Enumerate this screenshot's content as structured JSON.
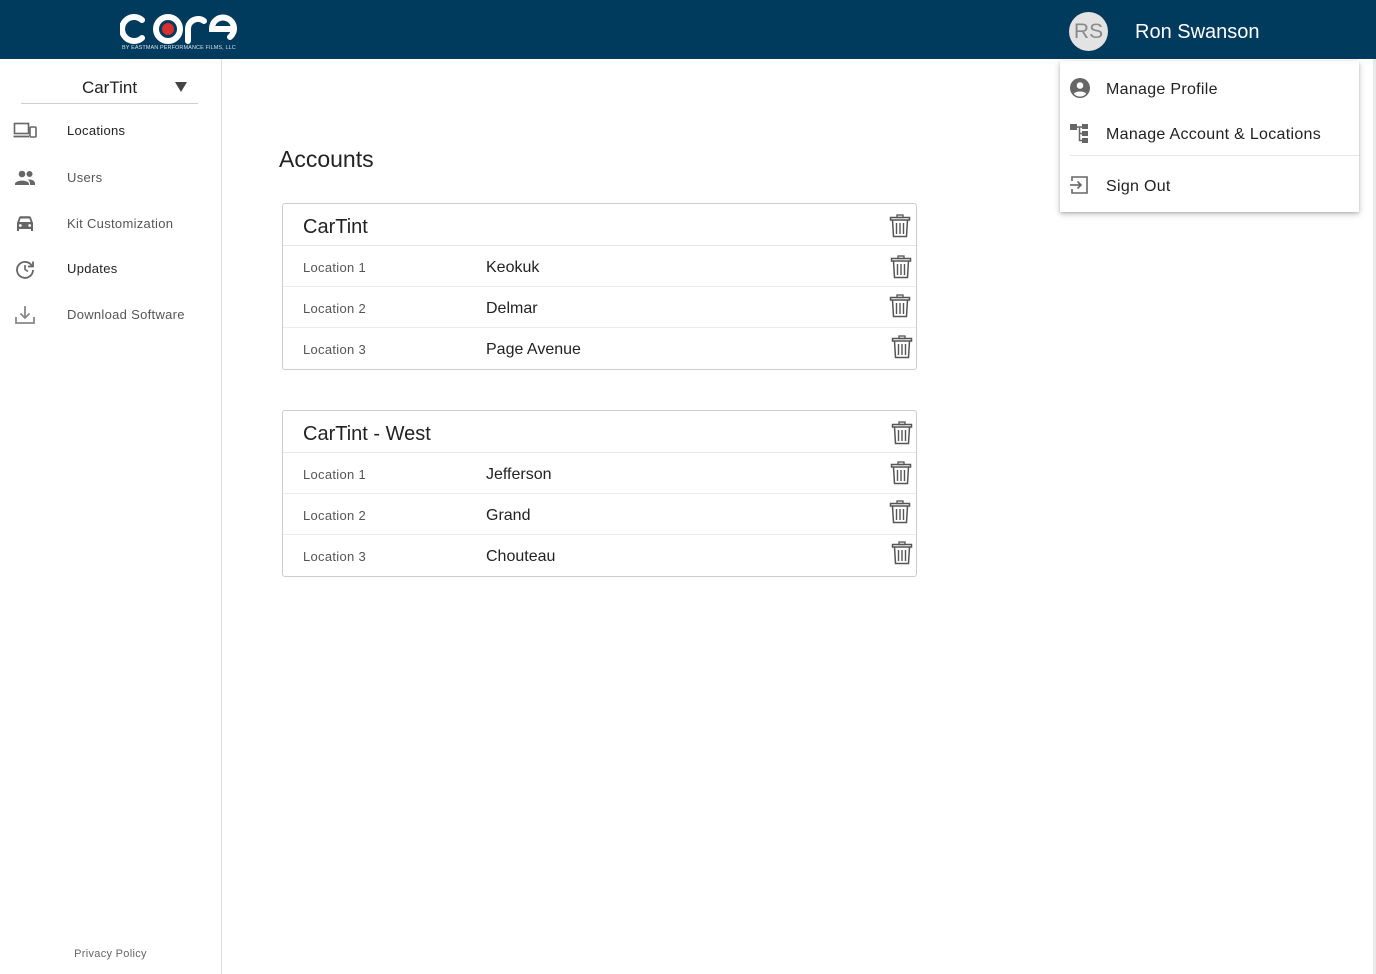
{
  "header": {
    "logo_text": "core",
    "logo_subtitle": "BY EASTMAN PERFORMANCE FILMS, LLC",
    "avatar_initials": "RS",
    "user_name": "Ron Swanson",
    "background_color": "#003a5d"
  },
  "sidebar": {
    "account_selector": "CarTint",
    "items": [
      {
        "label": "Locations",
        "icon": "devices-icon"
      },
      {
        "label": "Users",
        "icon": "people-icon"
      },
      {
        "label": "Kit Customization",
        "icon": "car-icon"
      },
      {
        "label": "Updates",
        "icon": "history-icon"
      },
      {
        "label": "Download Software",
        "icon": "download-icon"
      }
    ],
    "footer_link": "Privacy Policy"
  },
  "main": {
    "title": "Accounts",
    "accounts": [
      {
        "name": "CarTint",
        "locations": [
          {
            "label": "Location 1",
            "value": "Keokuk"
          },
          {
            "label": "Location 2",
            "value": "Delmar"
          },
          {
            "label": "Location 3",
            "value": "Page Avenue"
          }
        ]
      },
      {
        "name": "CarTint - West",
        "locations": [
          {
            "label": "Location 1",
            "value": "Jefferson"
          },
          {
            "label": "Location 2",
            "value": "Grand"
          },
          {
            "label": "Location 3",
            "value": "Chouteau"
          }
        ]
      }
    ]
  },
  "user_menu": {
    "items": [
      {
        "label": "Manage Profile",
        "icon": "account-circle-icon"
      },
      {
        "label": "Manage Account & Locations",
        "icon": "account-tree-icon"
      },
      {
        "label": "Sign Out",
        "icon": "sign-out-icon"
      }
    ]
  }
}
